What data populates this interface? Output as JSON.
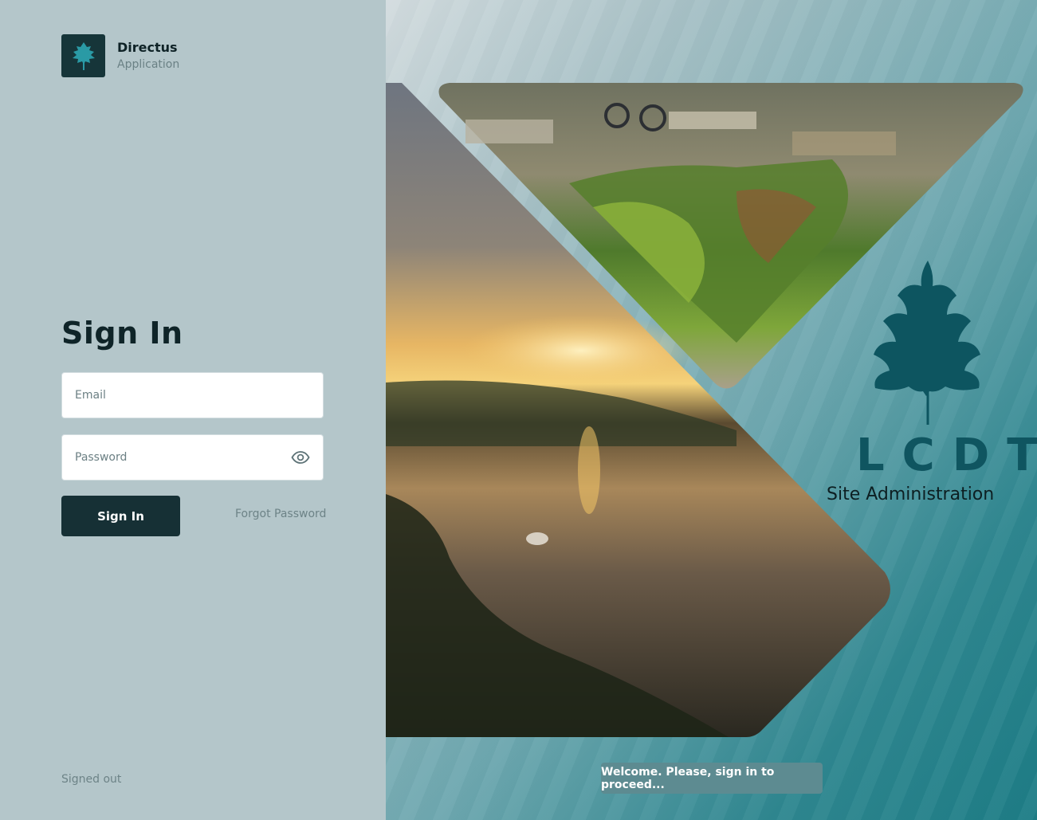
{
  "brand": {
    "icon": "leaf-icon",
    "name": "Directus",
    "subtitle": "Application"
  },
  "login": {
    "title": "Sign In",
    "email_placeholder": "Email",
    "email_value": "",
    "password_placeholder": "Password",
    "password_value": "",
    "password_toggle_icon": "eye-icon",
    "submit_label": "Sign In",
    "forgot_label": "Forgot Password",
    "status": "Signed out"
  },
  "hero": {
    "logo_icon": "oak-leaf-icon",
    "logo_letters": "LCDT",
    "logo_subtitle": "Site Administration",
    "toast": "Welcome. Please, sign in to proceed..."
  },
  "colors": {
    "panel": "#b4c6ca",
    "button": "#163035",
    "accent": "#0f5560",
    "toast": "#5d8b91"
  }
}
